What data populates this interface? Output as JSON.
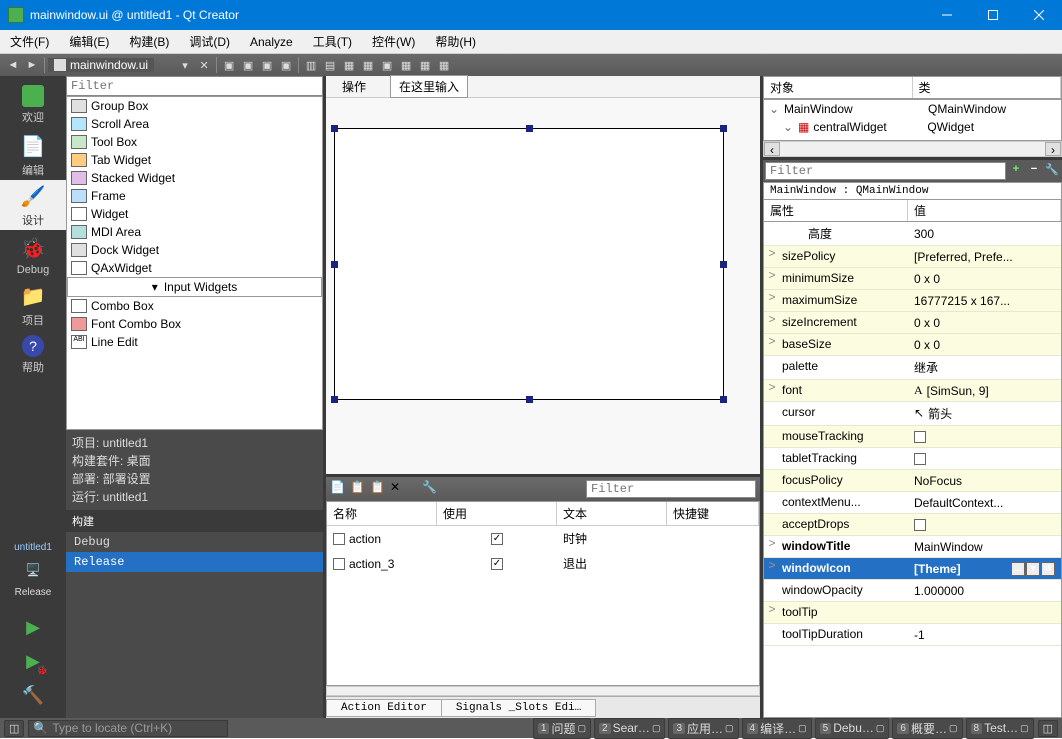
{
  "window": {
    "title": "mainwindow.ui @ untitled1 - Qt Creator"
  },
  "menubar": [
    "文件(F)",
    "编辑(E)",
    "构建(B)",
    "调试(D)",
    "Analyze",
    "工具(T)",
    "控件(W)",
    "帮助(H)"
  ],
  "filetab": "mainwindow.ui",
  "modes": [
    {
      "label": "欢迎",
      "icon": "welcome"
    },
    {
      "label": "编辑",
      "icon": "edit"
    },
    {
      "label": "设计",
      "icon": "design",
      "active": true
    },
    {
      "label": "Debug",
      "icon": "debug"
    },
    {
      "label": "项目",
      "icon": "project"
    },
    {
      "label": "帮助",
      "icon": "help"
    }
  ],
  "release_tabs": {
    "a": "untitled1",
    "b": "Release"
  },
  "widget_filter_placeholder": "Filter",
  "widget_items": [
    "Group Box",
    "Scroll Area",
    "Tool Box",
    "Tab Widget",
    "Stacked Widget",
    "Frame",
    "Widget",
    "MDI Area",
    "Dock Widget",
    "QAxWidget"
  ],
  "widget_header": "Input Widgets",
  "widget_items2": [
    "Combo Box",
    "Font Combo Box",
    "Line Edit"
  ],
  "project_info": {
    "project": "项目: untitled1",
    "kit": "构建套件: 桌面",
    "deploy": "部署: 部署设置",
    "run": "运行: untitled1"
  },
  "build": {
    "header": "构建",
    "items": [
      "Debug",
      "Release"
    ],
    "selected": 1
  },
  "canvas": {
    "operate": "操作",
    "input_here": "在这里输入"
  },
  "actions": {
    "filter": "Filter",
    "headers": [
      "名称",
      "使用",
      "文本",
      "快捷键"
    ],
    "rows": [
      {
        "name": "action",
        "use": true,
        "text": "时钟"
      },
      {
        "name": "action_3",
        "use": true,
        "text": "退出"
      }
    ],
    "tabs": [
      "Action Editor",
      "Signals _Slots Edi…"
    ]
  },
  "object_inspector": {
    "headers": [
      "对象",
      "类"
    ],
    "rows": [
      {
        "name": "MainWindow",
        "class": "QMainWindow",
        "indent": 0
      },
      {
        "name": "centralWidget",
        "class": "QWidget",
        "indent": 1
      }
    ]
  },
  "property": {
    "filter": "Filter",
    "class": "MainWindow : QMainWindow",
    "headers": [
      "属性",
      "值"
    ],
    "rows": [
      {
        "name": "高度",
        "value": "300",
        "indent": true
      },
      {
        "name": "sizePolicy",
        "value": "[Preferred, Prefe...",
        "yellow": true,
        "exp": ">"
      },
      {
        "name": "minimumSize",
        "value": "0 x 0",
        "yellow": true,
        "exp": ">"
      },
      {
        "name": "maximumSize",
        "value": "16777215 x 167...",
        "yellow": true,
        "exp": ">"
      },
      {
        "name": "sizeIncrement",
        "value": "0 x 0",
        "yellow": true,
        "exp": ">"
      },
      {
        "name": "baseSize",
        "value": "0 x 0",
        "yellow": true,
        "exp": ">"
      },
      {
        "name": "palette",
        "value": "继承"
      },
      {
        "name": "font",
        "value": "[SimSun, 9]",
        "yellow": true,
        "exp": ">",
        "icon": "A"
      },
      {
        "name": "cursor",
        "value": "箭头",
        "icon": "↖"
      },
      {
        "name": "mouseTracking",
        "value": "",
        "yellow": true,
        "check": true
      },
      {
        "name": "tabletTracking",
        "value": "",
        "check": true
      },
      {
        "name": "focusPolicy",
        "value": "NoFocus",
        "yellow": true
      },
      {
        "name": "contextMenu...",
        "value": "DefaultContext..."
      },
      {
        "name": "acceptDrops",
        "value": "",
        "yellow": true,
        "check": true
      },
      {
        "name": "windowTitle",
        "value": "MainWindow",
        "bold": true,
        "exp": ">"
      },
      {
        "name": "windowIcon",
        "value": "[Theme]",
        "selected": true,
        "exp": ">",
        "btns": true
      },
      {
        "name": "windowOpacity",
        "value": "1.000000"
      },
      {
        "name": "toolTip",
        "value": "",
        "yellow": true,
        "exp": ">"
      },
      {
        "name": "toolTipDuration",
        "value": "-1"
      }
    ]
  },
  "statusbar": {
    "locator": "Type to locate (Ctrl+K)",
    "items": [
      {
        "n": "1",
        "t": "问题"
      },
      {
        "n": "2",
        "t": "Sear…"
      },
      {
        "n": "3",
        "t": "应用…"
      },
      {
        "n": "4",
        "t": "编译…"
      },
      {
        "n": "5",
        "t": "Debu…"
      },
      {
        "n": "6",
        "t": "概要…"
      },
      {
        "n": "8",
        "t": "Test…"
      }
    ]
  }
}
